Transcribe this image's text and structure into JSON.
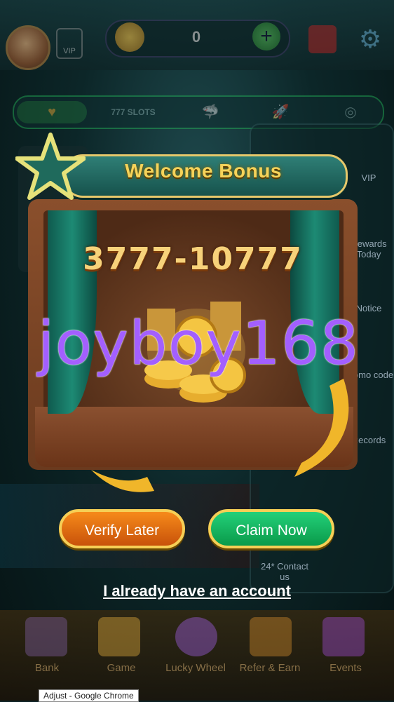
{
  "topbar": {
    "vip_label": "VIP",
    "balance": "0",
    "plus_symbol": "+"
  },
  "categories": [
    "",
    "777 SLOTS",
    "",
    "",
    ""
  ],
  "side_menu": {
    "items": [
      "VIP",
      "Rewards Today",
      "Notice",
      "Promo code",
      "Records",
      "24* Contact us"
    ]
  },
  "modal": {
    "title": "Welcome Bonus",
    "bonus_range": "3777-10777",
    "watermark": "joyboy168",
    "verify_button": "Verify Later",
    "claim_button": "Claim Now",
    "account_link": "I already have an account"
  },
  "bottom_nav": {
    "items": [
      "Bank",
      "Game",
      "Lucky Wheel",
      "Refer & Earn",
      "Events"
    ]
  },
  "tooltip": "Adjust - Google Chrome",
  "colors": {
    "title_gold": "#f5d35a",
    "ribbon_teal": "#2f7f76",
    "verify_orange": "#f68a1a",
    "claim_green": "#23d07a",
    "watermark_purple": "#a35fff"
  }
}
